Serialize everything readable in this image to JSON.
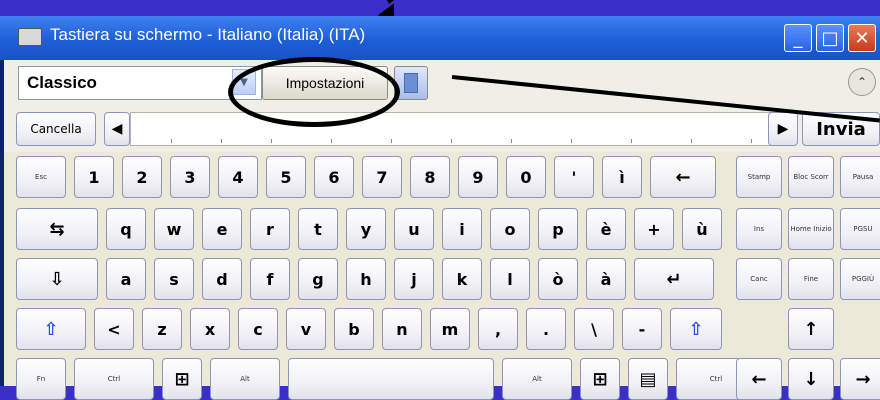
{
  "window": {
    "title": "Tastiera su schermo - Italiano (Italia) (ITA)",
    "buttons": {
      "minimize": "_",
      "maximize": "□",
      "close": "✕"
    }
  },
  "toolbar": {
    "layout_value": "Classico",
    "settings_label": "Impostazioni",
    "collapse_icon": "⌃"
  },
  "prediction": {
    "clear_label": "Cancella",
    "prev": "◀",
    "next": "▶",
    "send_label": "Invia"
  },
  "keyboard": {
    "row1": [
      "Esc",
      "1",
      "2",
      "3",
      "4",
      "5",
      "6",
      "7",
      "8",
      "9",
      "0",
      "'",
      "ì",
      "←"
    ],
    "row2": [
      "⇆",
      "q",
      "w",
      "e",
      "r",
      "t",
      "y",
      "u",
      "i",
      "o",
      "p",
      "è",
      "+",
      "ù"
    ],
    "row3": [
      "⇩",
      "a",
      "s",
      "d",
      "f",
      "g",
      "h",
      "j",
      "k",
      "l",
      "ò",
      "à",
      "↵"
    ],
    "row4": [
      "⇧",
      "<",
      "z",
      "x",
      "c",
      "v",
      "b",
      "n",
      "m",
      ",",
      ".",
      "\\",
      "-",
      "⇧"
    ],
    "row5": [
      "Fn",
      "Ctrl",
      "⊞",
      "Alt",
      "",
      "Alt",
      "⊞",
      "▤",
      "Ctrl"
    ]
  },
  "nav": {
    "r1": [
      "Stamp",
      "Bloc Scorr",
      "Pausa"
    ],
    "r2": [
      "Ins",
      "Home Inizio",
      "PGSU"
    ],
    "r3": [
      "Canc",
      "Fine",
      "PGGIÙ"
    ],
    "up": "↑",
    "bottom": [
      "←",
      "↓",
      "→"
    ]
  },
  "colors": {
    "titlebar": "#1d5fd8",
    "background": "#3b2fc9",
    "client": "#ece9d8",
    "key_border": "#8e94ba"
  }
}
